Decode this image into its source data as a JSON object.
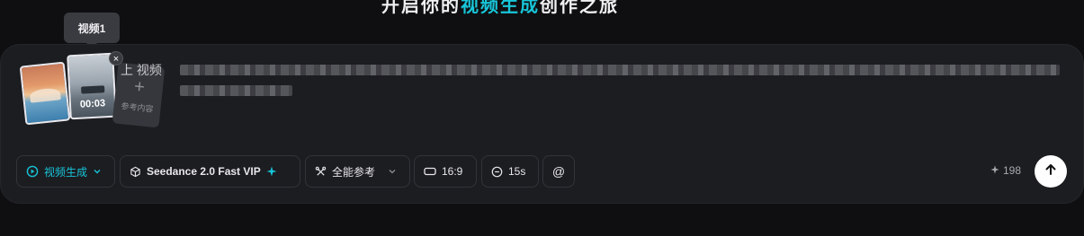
{
  "headline": {
    "part1": "开启你的",
    "accent": "视频生成",
    "part2": "创作之旅"
  },
  "tooltip": "视频1",
  "media": {
    "video_duration": "00:03",
    "add_reference_label": "参考内容",
    "add_icon": "plus-icon",
    "remove_icon": "close-icon"
  },
  "prompt": {
    "prefix": "上 ",
    "mention": "视频"
  },
  "toolbar": {
    "mode_label": "视频生成",
    "model_label": "Seedance 2.0 Fast VIP",
    "reference_label": "全能参考",
    "ratio_label": "16:9",
    "duration_label": "15s",
    "mention_label": "@"
  },
  "credits": "198",
  "colors": {
    "accent": "#16c4d8",
    "panel": "#1c1d21",
    "background": "#0f0f11"
  }
}
